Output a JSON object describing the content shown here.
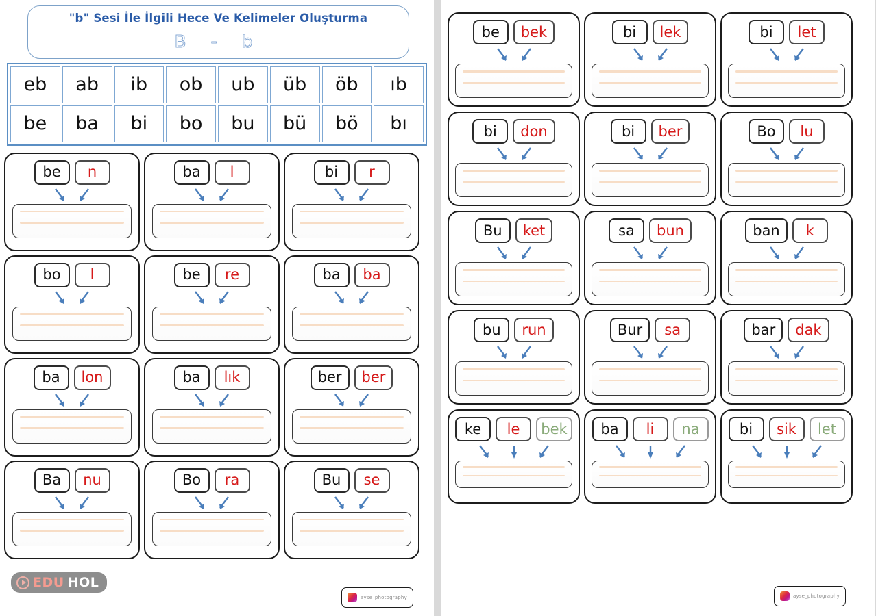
{
  "document": {
    "title_main": "\"b\" Sesi İle İlgili Hece Ve Kelimeler Oluşturma",
    "title_letters": "B  -  b",
    "accent_blue": "#2b5ca8",
    "border_blue": "#5b8fc4",
    "syllable_red": "#d61a1a",
    "syllable_green": "#8aab7a",
    "rule_color": "#f7ddc6",
    "arrow_color": "#4a7ebb"
  },
  "syllable_table": {
    "row1": [
      "eb",
      "ab",
      "ib",
      "ob",
      "ub",
      "üb",
      "öb",
      "ıb"
    ],
    "row2": [
      "be",
      "ba",
      "bi",
      "bo",
      "bu",
      "bü",
      "bö",
      "bı"
    ]
  },
  "left_page_cards": [
    {
      "parts": [
        {
          "text": "be",
          "color": "black"
        },
        {
          "text": "n",
          "color": "red"
        }
      ]
    },
    {
      "parts": [
        {
          "text": "ba",
          "color": "black"
        },
        {
          "text": "l",
          "color": "red"
        }
      ]
    },
    {
      "parts": [
        {
          "text": "bi",
          "color": "black"
        },
        {
          "text": "r",
          "color": "red"
        }
      ]
    },
    {
      "parts": [
        {
          "text": "bo",
          "color": "black"
        },
        {
          "text": "l",
          "color": "red"
        }
      ]
    },
    {
      "parts": [
        {
          "text": "be",
          "color": "black"
        },
        {
          "text": "re",
          "color": "red"
        }
      ]
    },
    {
      "parts": [
        {
          "text": "ba",
          "color": "black"
        },
        {
          "text": "ba",
          "color": "red"
        }
      ]
    },
    {
      "parts": [
        {
          "text": "ba",
          "color": "black"
        },
        {
          "text": "lon",
          "color": "red"
        }
      ]
    },
    {
      "parts": [
        {
          "text": "ba",
          "color": "black"
        },
        {
          "text": "lık",
          "color": "red"
        }
      ]
    },
    {
      "parts": [
        {
          "text": "ber",
          "color": "black"
        },
        {
          "text": "ber",
          "color": "red"
        }
      ]
    },
    {
      "parts": [
        {
          "text": "Ba",
          "color": "black"
        },
        {
          "text": "nu",
          "color": "red"
        }
      ]
    },
    {
      "parts": [
        {
          "text": "Bo",
          "color": "black"
        },
        {
          "text": "ra",
          "color": "red"
        }
      ]
    },
    {
      "parts": [
        {
          "text": "Bu",
          "color": "black"
        },
        {
          "text": "se",
          "color": "red"
        }
      ]
    }
  ],
  "right_page_cards": [
    {
      "parts": [
        {
          "text": "be",
          "color": "black"
        },
        {
          "text": "bek",
          "color": "red"
        }
      ]
    },
    {
      "parts": [
        {
          "text": "bi",
          "color": "black"
        },
        {
          "text": "lek",
          "color": "red"
        }
      ]
    },
    {
      "parts": [
        {
          "text": "bi",
          "color": "black"
        },
        {
          "text": "let",
          "color": "red"
        }
      ]
    },
    {
      "parts": [
        {
          "text": "bi",
          "color": "black"
        },
        {
          "text": "don",
          "color": "red"
        }
      ]
    },
    {
      "parts": [
        {
          "text": "bi",
          "color": "black"
        },
        {
          "text": "ber",
          "color": "red"
        }
      ]
    },
    {
      "parts": [
        {
          "text": "Bo",
          "color": "black"
        },
        {
          "text": "lu",
          "color": "red"
        }
      ]
    },
    {
      "parts": [
        {
          "text": "Bu",
          "color": "black"
        },
        {
          "text": "ket",
          "color": "red"
        }
      ]
    },
    {
      "parts": [
        {
          "text": "sa",
          "color": "black"
        },
        {
          "text": "bun",
          "color": "red"
        }
      ]
    },
    {
      "parts": [
        {
          "text": "ban",
          "color": "black"
        },
        {
          "text": "k",
          "color": "red"
        }
      ]
    },
    {
      "parts": [
        {
          "text": "bu",
          "color": "black"
        },
        {
          "text": "run",
          "color": "red"
        }
      ]
    },
    {
      "parts": [
        {
          "text": "Bur",
          "color": "black"
        },
        {
          "text": "sa",
          "color": "red"
        }
      ]
    },
    {
      "parts": [
        {
          "text": "bar",
          "color": "black"
        },
        {
          "text": "dak",
          "color": "red"
        }
      ]
    },
    {
      "parts": [
        {
          "text": "ke",
          "color": "black"
        },
        {
          "text": "le",
          "color": "red"
        },
        {
          "text": "bek",
          "color": "green"
        }
      ]
    },
    {
      "parts": [
        {
          "text": "ba",
          "color": "black"
        },
        {
          "text": "li",
          "color": "red"
        },
        {
          "text": "na",
          "color": "green"
        }
      ]
    },
    {
      "parts": [
        {
          "text": "bi",
          "color": "black"
        },
        {
          "text": "sik",
          "color": "red"
        },
        {
          "text": "let",
          "color": "green"
        }
      ]
    }
  ],
  "watermarks": {
    "eduhol_edu": "EDU",
    "eduhol_hol": "HOL",
    "photo_handle": "ayse_photography"
  }
}
